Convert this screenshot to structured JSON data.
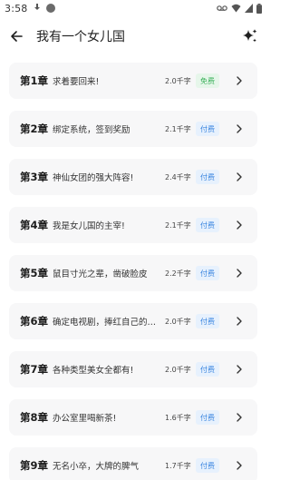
{
  "status_bar": {
    "time": "3:58",
    "icons": [
      "download-icon",
      "circle-icon",
      "voicemail-icon",
      "wifi-icon",
      "signal-icon",
      "battery-icon"
    ]
  },
  "header": {
    "title": "我有一个女儿国",
    "back_icon": "arrow-left-icon",
    "action_icon": "sparkle-icon"
  },
  "chapters": [
    {
      "number": "第1章",
      "title": "求着要回来!",
      "words": "2.0千字",
      "badge": "免费",
      "badge_type": "free"
    },
    {
      "number": "第2章",
      "title": "绑定系统，签到奖励",
      "words": "2.1千字",
      "badge": "付费",
      "badge_type": "paid"
    },
    {
      "number": "第3章",
      "title": "神仙女团的强大阵容!",
      "words": "2.4千字",
      "badge": "付费",
      "badge_type": "paid"
    },
    {
      "number": "第4章",
      "title": "我是女儿国的主宰!",
      "words": "2.1千字",
      "badge": "付费",
      "badge_type": "paid"
    },
    {
      "number": "第5章",
      "title": "鼠目寸光之辈，凿破脸皮",
      "words": "2.2千字",
      "badge": "付费",
      "badge_type": "paid"
    },
    {
      "number": "第6章",
      "title": "确定电视剧，捧红自己的…",
      "words": "2.0千字",
      "badge": "付费",
      "badge_type": "paid"
    },
    {
      "number": "第7章",
      "title": "各种类型美女全都有!",
      "words": "2.0千字",
      "badge": "付费",
      "badge_type": "paid"
    },
    {
      "number": "第8章",
      "title": "办公室里喝新茶!",
      "words": "1.6千字",
      "badge": "付费",
      "badge_type": "paid"
    },
    {
      "number": "第9章",
      "title": "无名小卒，大牌的脾气",
      "words": "1.7千字",
      "badge": "付费",
      "badge_type": "paid"
    }
  ],
  "colors": {
    "card_bg": "#f7f7f8",
    "free_badge_bg": "#e6f6ea",
    "free_badge_text": "#3bb05a",
    "paid_badge_bg": "#e7f1fd",
    "paid_badge_text": "#3b86e0"
  }
}
